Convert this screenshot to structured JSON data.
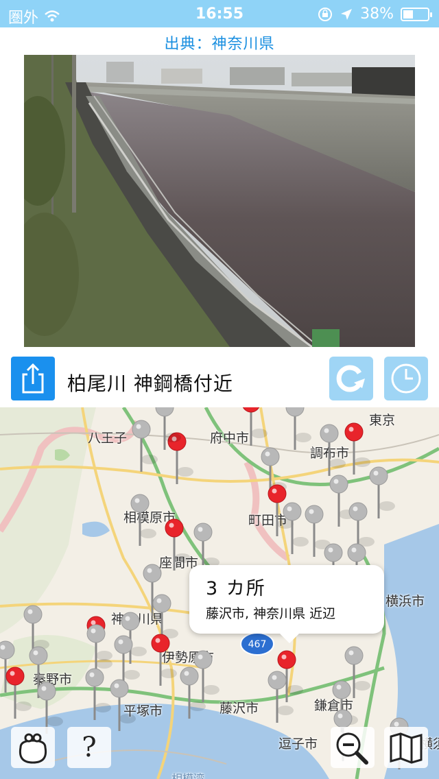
{
  "status_bar": {
    "carrier": "圏外",
    "time": "16:55",
    "battery_percent": "38%",
    "battery_level": 0.38
  },
  "source_label": "出典：神奈川県",
  "camera": {
    "title": "柏尾川  神鋼橋付近"
  },
  "map": {
    "labels": [
      "東京",
      "八王子",
      "府中市",
      "調布市",
      "相模原市",
      "町田市",
      "座間市",
      "横浜市",
      "神奈川県",
      "伊勢原市",
      "秦野市",
      "平塚市",
      "藤沢市",
      "鎌倉市",
      "逗子市",
      "横須",
      "相模湾"
    ],
    "callout": {
      "title": "3 カ所",
      "subtitle": "藤沢市, 神奈川県 近辺"
    },
    "route_shield": "467"
  },
  "buttons": {
    "help": "?"
  },
  "colors": {
    "status_bar": "#8fd3f7",
    "source_text": "#1a8fe0",
    "share_button": "#1a90ee",
    "control_buttons": "#9fd5f5",
    "pin_red": "#e8242b",
    "pin_gray": "#b8b8b8"
  }
}
